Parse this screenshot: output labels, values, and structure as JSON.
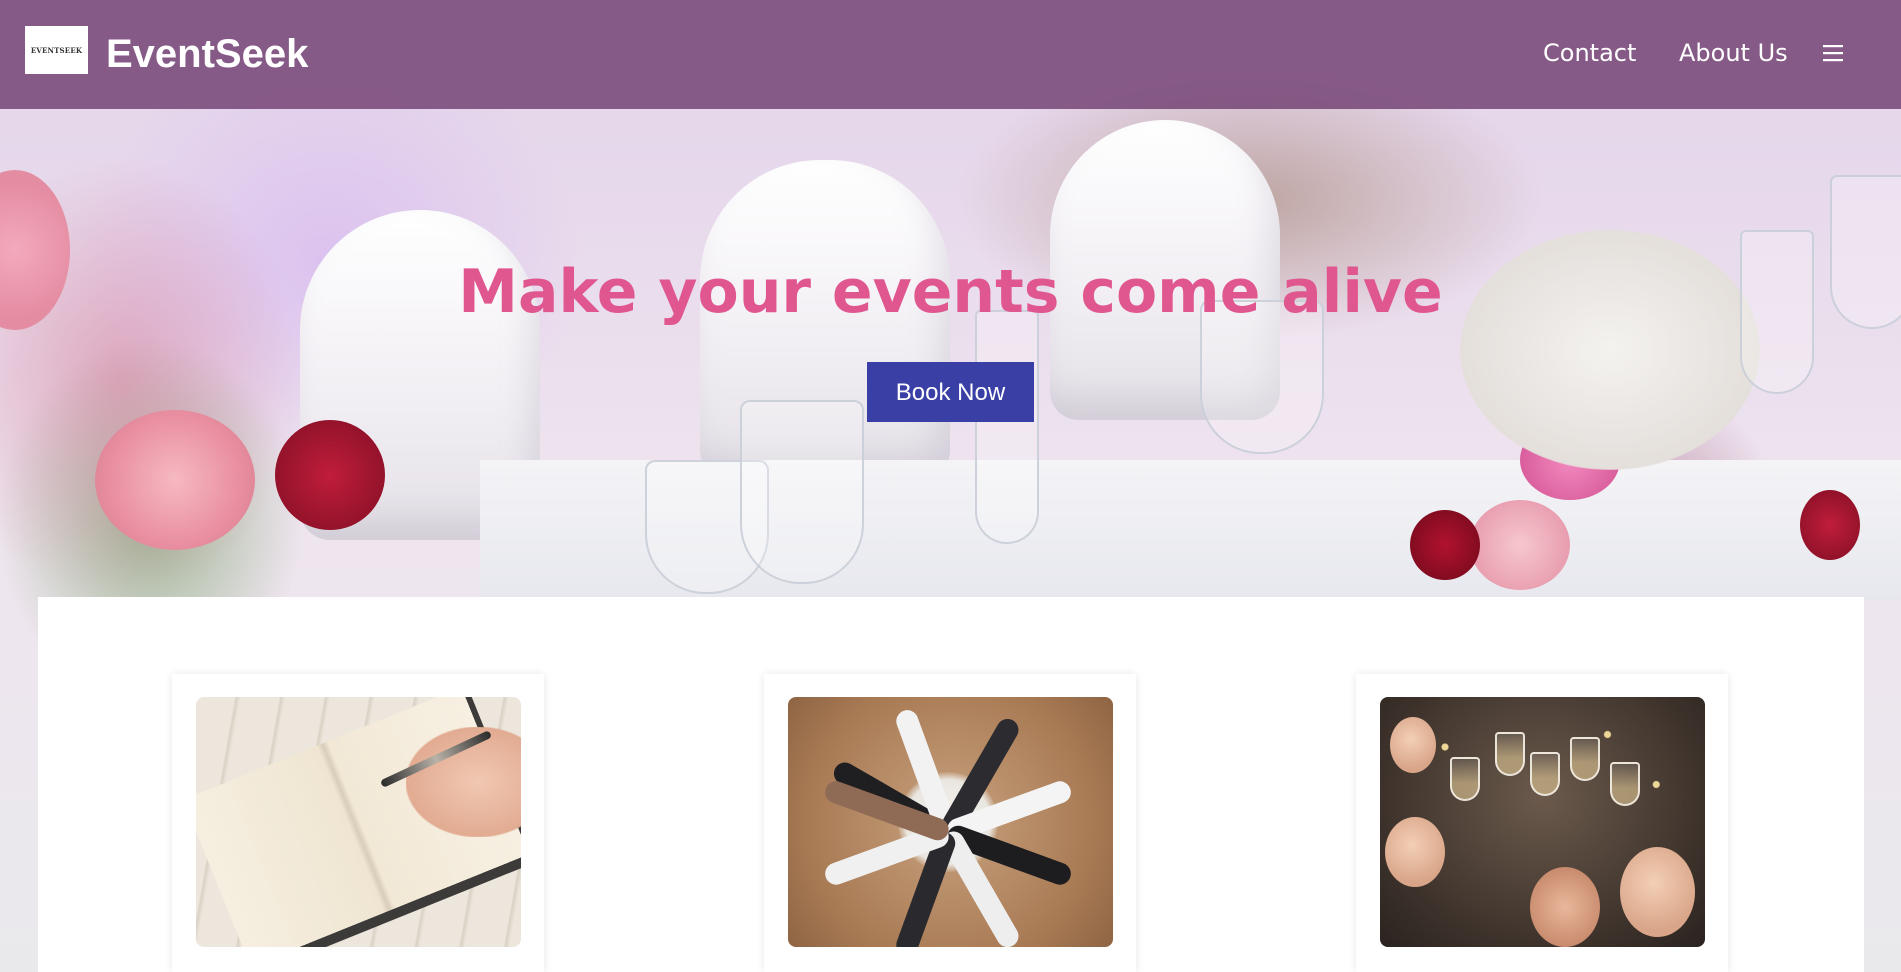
{
  "header": {
    "logo_text": "EVENTSEEK",
    "brand": "EventSeek",
    "nav": {
      "contact": "Contact",
      "about": "About Us",
      "menu_icon": "hamburger-menu-icon"
    }
  },
  "hero": {
    "title": "Make your events come alive",
    "cta_label": "Book Now"
  },
  "cards": [
    {
      "image": "notebook-writing-plan-photo"
    },
    {
      "image": "team-puzzle-hands-photo"
    },
    {
      "image": "celebration-toast-photo"
    }
  ],
  "colors": {
    "header_bg": "#764476",
    "accent_pink": "#e0578f",
    "button_blue": "#3a3fa6"
  }
}
